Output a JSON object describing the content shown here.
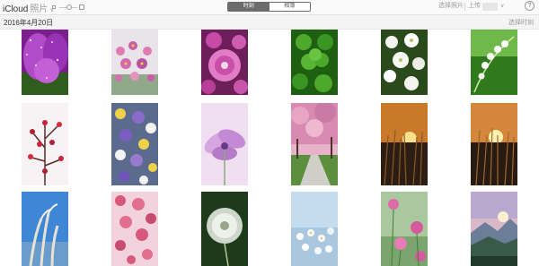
{
  "toolbar": {
    "brand": "iCloud",
    "app_name": "照片",
    "app_caret": "∨",
    "segments": [
      {
        "label": "时刻",
        "selected": true
      },
      {
        "label": "相簿",
        "selected": false
      }
    ],
    "select_photos": "选择照片",
    "upload": "上传",
    "dropdown_caret": "∨",
    "help": "?"
  },
  "moment": {
    "date": "2016年4月20日",
    "select_moment": "选择时刻"
  },
  "colors": {
    "toolbar_bg": "#fafafa",
    "date_bar_bg": "#f4f4f4",
    "segment_selected": "#6c6c6c",
    "muted_text": "#9a9a9a"
  },
  "photos": [
    {
      "subject": "purple-crocus"
    },
    {
      "subject": "pink-daisies"
    },
    {
      "subject": "magenta-aster"
    },
    {
      "subject": "green-clover"
    },
    {
      "subject": "white-dogwood"
    },
    {
      "subject": "lily-of-the-valley"
    },
    {
      "subject": "red-plum-blossom"
    },
    {
      "subject": "wildflower-meadow"
    },
    {
      "subject": "soft-purple-bloom"
    },
    {
      "subject": "cherry-blossom-path"
    },
    {
      "subject": "sunset-grass"
    },
    {
      "subject": "sunset-grass-2"
    },
    {
      "subject": "pampas-grass-blue-sky"
    },
    {
      "subject": "pink-blossom-branches"
    },
    {
      "subject": "dandelion-seed-head"
    },
    {
      "subject": "white-flowers-blue"
    },
    {
      "subject": "pink-cosmos"
    },
    {
      "subject": "valley-sunrise"
    }
  ]
}
